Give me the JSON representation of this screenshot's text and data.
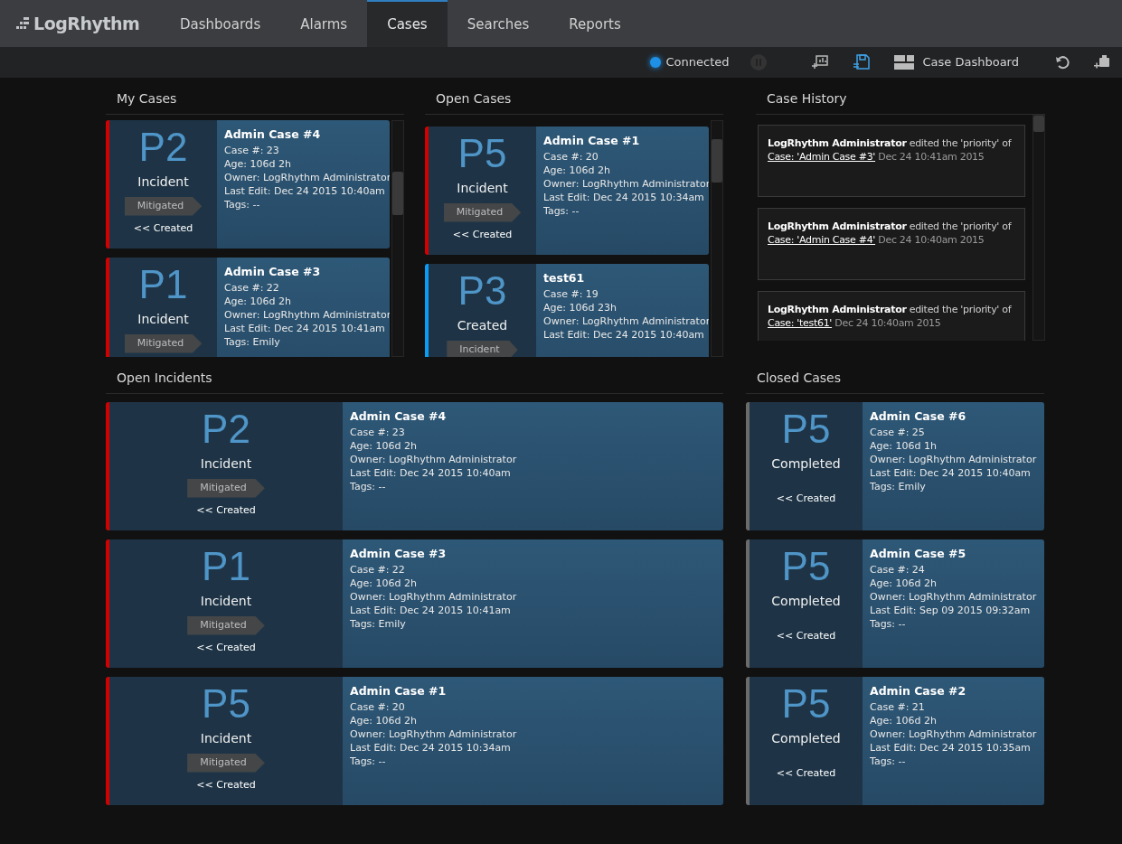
{
  "app": {
    "logo": "LogRhythm"
  },
  "nav_tabs": [
    {
      "label": "Dashboards",
      "selected": false
    },
    {
      "label": "Alarms",
      "selected": false
    },
    {
      "label": "Cases",
      "selected": true
    },
    {
      "label": "Searches",
      "selected": false
    },
    {
      "label": "Reports",
      "selected": false
    }
  ],
  "toolbar": {
    "connection": "Connected",
    "dashboard": "Case Dashboard"
  },
  "my_cases": {
    "title": "My Cases",
    "cases": [
      {
        "priority": "P2",
        "type": "Incident",
        "tag": "Mitigated",
        "back_link": "<< Created",
        "color": "#d40000",
        "title": "Admin Case #4",
        "lines": [
          "Case #: 23",
          "Age: 106d 2h",
          "Owner: LogRhythm Administrator",
          "Last Edit: Dec 24 2015 10:40am",
          "Tags: --"
        ]
      },
      {
        "priority": "P1",
        "type": "Incident",
        "tag": "Mitigated",
        "color": "#d40000",
        "title": "Admin Case #3",
        "lines": [
          "Case #: 22",
          "Age: 106d 2h",
          "Owner: LogRhythm Administrator",
          "Last Edit: Dec 24 2015 10:41am",
          "Tags: Emily"
        ]
      }
    ]
  },
  "open_cases": {
    "title": "Open Cases",
    "cases": [
      {
        "priority": "P5",
        "type": "Incident",
        "tag": "Mitigated",
        "back_link": "<< Created",
        "color": "#d40000",
        "title": "Admin Case #1",
        "lines": [
          "Case #: 20",
          "Age: 106d 2h",
          "Owner: LogRhythm Administrator",
          "Last Edit: Dec 24 2015 10:34am",
          "Tags: --"
        ]
      },
      {
        "priority": "P3",
        "type": "Created",
        "tag": "Incident",
        "color": "#0a9cf5",
        "title": "test61",
        "lines": [
          "Case #: 19",
          "Age: 106d 23h",
          "Owner: LogRhythm Administrator",
          "Last Edit: Dec 24 2015 10:40am"
        ]
      }
    ]
  },
  "case_history": {
    "title": "Case History",
    "entries": [
      {
        "user": "LogRhythm Administrator",
        "action": "edited the 'priority' of",
        "link": "Case: 'Admin Case #3'",
        "time": "Dec 24 10:41am 2015"
      },
      {
        "user": "LogRhythm Administrator",
        "action": "edited the 'priority' of",
        "link": "Case: 'Admin Case #4'",
        "time": "Dec 24 10:40am 2015"
      },
      {
        "user": "LogRhythm Administrator",
        "action": "edited the 'priority' of",
        "link": "Case: 'test61'",
        "time": "Dec 24 10:40am 2015"
      }
    ]
  },
  "open_incidents": {
    "title": "Open Incidents",
    "cases": [
      {
        "priority": "P2",
        "type": "Incident",
        "tag": "Mitigated",
        "back_link": "<< Created",
        "color": "#d40000",
        "title": "Admin Case #4",
        "lines": [
          "Case #: 23",
          "Age: 106d 2h",
          "Owner: LogRhythm Administrator",
          "Last Edit: Dec 24 2015 10:40am",
          "Tags: --"
        ]
      },
      {
        "priority": "P1",
        "type": "Incident",
        "tag": "Mitigated",
        "back_link": "<< Created",
        "color": "#d40000",
        "title": "Admin Case #3",
        "lines": [
          "Case #: 22",
          "Age: 106d 2h",
          "Owner: LogRhythm Administrator",
          "Last Edit: Dec 24 2015 10:41am",
          "Tags: Emily"
        ]
      },
      {
        "priority": "P5",
        "type": "Incident",
        "tag": "Mitigated",
        "back_link": "<< Created",
        "color": "#d40000",
        "title": "Admin Case #1",
        "lines": [
          "Case #: 20",
          "Age: 106d 2h",
          "Owner: LogRhythm Administrator",
          "Last Edit: Dec 24 2015 10:34am",
          "Tags: --"
        ]
      }
    ]
  },
  "closed_cases": {
    "title": "Closed Cases",
    "cases": [
      {
        "priority": "P5",
        "type": "Completed",
        "back_link": "<< Created",
        "color": "#6b6b6b",
        "title": "Admin Case #6",
        "lines": [
          "Case #: 25",
          "Age: 106d 1h",
          "Owner: LogRhythm Administrator",
          "Last Edit: Dec 24 2015 10:40am",
          "Tags: Emily"
        ]
      },
      {
        "priority": "P5",
        "type": "Completed",
        "back_link": "<< Created",
        "color": "#6b6b6b",
        "title": "Admin Case #5",
        "lines": [
          "Case #: 24",
          "Age: 106d 2h",
          "Owner: LogRhythm Administrator",
          "Last Edit: Sep 09 2015 09:32am",
          "Tags: --"
        ]
      },
      {
        "priority": "P5",
        "type": "Completed",
        "back_link": "<< Created",
        "color": "#6b6b6b",
        "title": "Admin Case #2",
        "lines": [
          "Case #: 21",
          "Age: 106d 2h",
          "Owner: LogRhythm Administrator",
          "Last Edit: Dec 24 2015 10:35am",
          "Tags: --"
        ]
      }
    ]
  }
}
